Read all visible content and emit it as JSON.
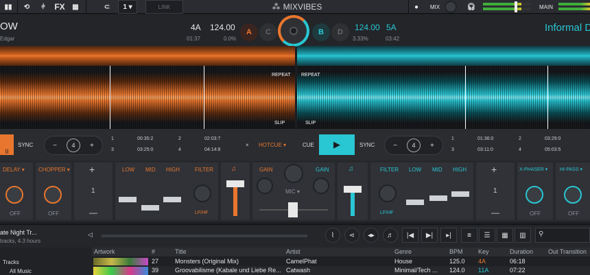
{
  "toolbar": {
    "fx_label": "FX",
    "deck_num": "1",
    "link_label": "LINK",
    "logo": "MIXVIBES",
    "mix_label": "MIX",
    "main_label": "MAIN"
  },
  "deckA": {
    "title": "OW",
    "artist": "Edgar",
    "key": "4A",
    "bpm": "124.00",
    "time": "01:37",
    "pitch": "0.0%",
    "deck_a": "A",
    "deck_c": "C",
    "cues": [
      {
        "n": "1",
        "t": "00:35:2"
      },
      {
        "n": "2",
        "t": "02:03:7"
      },
      {
        "n": "3",
        "t": "03:25:0"
      },
      {
        "n": "4",
        "t": "04:14:8"
      }
    ],
    "repeat": "REPEAT",
    "slip": "SLIP",
    "sync": "SYNC",
    "loop": "4",
    "hotcue": "HOTCUE"
  },
  "deckB": {
    "title": "Informal D",
    "key": "5A",
    "bpm": "124.00",
    "time": "03:42",
    "pitch": "3.33%",
    "deck_b": "B",
    "deck_d": "D",
    "cues": [
      {
        "n": "1",
        "t": "01:36:0"
      },
      {
        "n": "2",
        "t": "03:29:0"
      },
      {
        "n": "3",
        "t": "03:11:0"
      },
      {
        "n": "4",
        "t": "05:03:5"
      }
    ],
    "repeat": "REPEAT",
    "slip": "SLIP",
    "cue": "CUE",
    "sync": "SYNC",
    "loop": "4"
  },
  "mixer": {
    "delay": "DELAY",
    "chopper": "CHOPPER",
    "off": "OFF",
    "fx_num": "1",
    "low": "LOW",
    "mid": "MID",
    "high": "HIGH",
    "filter": "FILTER",
    "lfhf": "LF/HF",
    "gain": "GAIN",
    "mic": "MIC",
    "xphaser": "X-PHASER",
    "hipass": "HI-PASS",
    "plus": "+",
    "minus": "—"
  },
  "browser": {
    "playlist": "ate Night Tr...",
    "playlist_sub": "tracks, 4.3 hours",
    "tree": [
      "Tracks",
      "All Music"
    ],
    "columns": [
      "Artwork",
      "#",
      "Title",
      "Artist",
      "Genre",
      "BPM",
      "Key",
      "Duration",
      "Out Transition"
    ],
    "rows": [
      {
        "num": "27",
        "title": "Monsters (Original Mix)",
        "artist": "CamelPhat",
        "genre": "House",
        "bpm": "125.0",
        "key": "4A",
        "dur": "06:18"
      },
      {
        "num": "39",
        "title": "Groovabilisme (Kabale und Liebe Re...",
        "artist": "Catwash",
        "genre": "Minimal/Tech ...",
        "bpm": "124.0",
        "key": "11A",
        "dur": "07:22"
      }
    ]
  },
  "colors": {
    "orange": "#e8762e",
    "cyan": "#29c6d3",
    "bg": "#1b1d21"
  }
}
